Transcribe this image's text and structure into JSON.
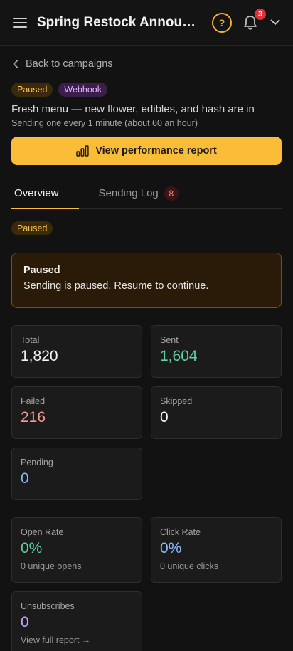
{
  "header": {
    "title": "Spring Restock Announc...",
    "help_icon": "question-circle-icon",
    "notification_count": "3"
  },
  "nav": {
    "back_label": "Back to campaigns"
  },
  "campaign": {
    "tags": [
      "Paused",
      "Webhook"
    ],
    "description": "Fresh menu — new flower, edibles, and hash are in",
    "schedule": "Sending one every 1 minute (about 60 an hour)"
  },
  "actions": {
    "performance_report": "View performance report"
  },
  "tabs": [
    {
      "label": "Overview",
      "active": true
    },
    {
      "label": "Sending Log",
      "count": "8"
    }
  ],
  "status_badge": "Paused",
  "alert": {
    "title": "Paused",
    "message": "Sending is paused. Resume to continue."
  },
  "stats": {
    "total": {
      "label": "Total",
      "value": "1,820"
    },
    "sent": {
      "label": "Sent",
      "value": "1,604"
    },
    "failed": {
      "label": "Failed",
      "value": "216"
    },
    "skipped": {
      "label": "Skipped",
      "value": "0"
    },
    "pending": {
      "label": "Pending",
      "value": "0"
    },
    "open_rate": {
      "label": "Open Rate",
      "value": "0%",
      "sub": "0 unique opens"
    },
    "click_rate": {
      "label": "Click Rate",
      "value": "0%",
      "sub": "0 unique clicks"
    },
    "unsubscribes": {
      "label": "Unsubscribes",
      "value": "0",
      "sub": "View full report →"
    }
  },
  "colors": {
    "accent": "#fbbd37",
    "success": "#5bd2a0",
    "danger": "#f29a9a",
    "info": "#8ab8ff",
    "purple": "#c9a6ff"
  }
}
